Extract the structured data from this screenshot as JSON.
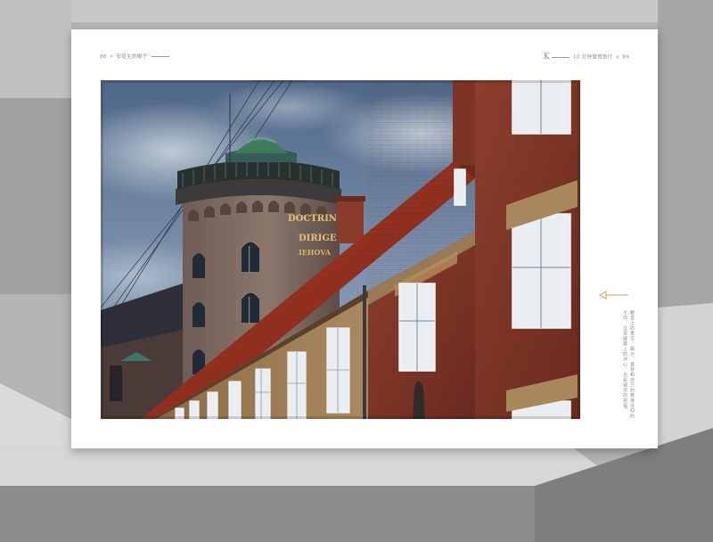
{
  "page": {
    "left_header": {
      "page_number": "88",
      "section_title": "安徒生的帽子"
    },
    "right_header": {
      "section_letter": "K",
      "chapter_title": "10 分钟慢赏旅行",
      "page_number": "89"
    },
    "caption": "教堂上的金字，顯示，基督和自己的教導信仰的方向，這是建築上的決心，也是城市的祝福。"
  },
  "photo": {
    "subject": "round tower with red-brick buildings",
    "tower_sign_lines": [
      "DOCTRIN",
      "DIRIGE",
      "IEHOVA"
    ]
  },
  "colors": {
    "backdrop": "#a9aaac",
    "page": "#ffffff",
    "accent_blue": "#7ea8c9",
    "brick": "#8a3b2a",
    "roof": "#9a3123",
    "sky": "#6f86a3",
    "dome": "#3f7a5c"
  },
  "icons": [
    "cross-icon",
    "left-arrow-icon"
  ]
}
